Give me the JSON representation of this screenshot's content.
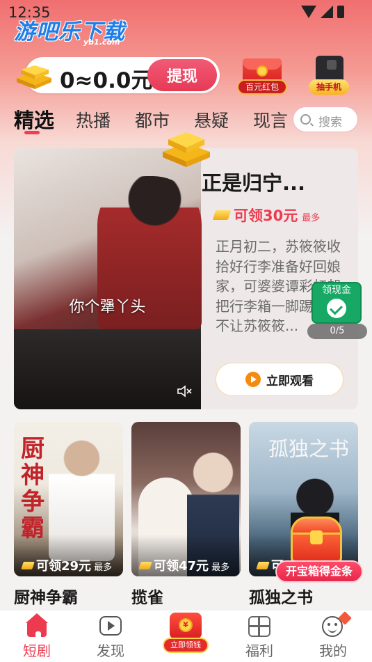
{
  "status_bar": {
    "time": "12:35"
  },
  "logo": {
    "name": "游吧乐下载",
    "domain": "yb1.com"
  },
  "coins": {
    "balance": "0≈0.0元",
    "withdraw_label": "提现"
  },
  "promos": {
    "red_packet_label": "百元红包",
    "phone_label": "抽手机"
  },
  "tabs": [
    {
      "label": "精选",
      "active": true
    },
    {
      "label": "热播"
    },
    {
      "label": "都市"
    },
    {
      "label": "悬疑"
    },
    {
      "label": "现言"
    }
  ],
  "search": {
    "placeholder": "搜索"
  },
  "featured": {
    "title": "正是归宁...",
    "reward": "可领30元",
    "reward_more": "最多",
    "description": "正月初二，苏筱筱收拾好行李准备好回娘家，可婆婆谭彩虹却把行李箱一脚踢翻，不让苏筱筱...",
    "subtitle": "你个犟丫头",
    "watch_label": "立即观看"
  },
  "cash_widget": {
    "title": "领现金",
    "progress": "0/5"
  },
  "dramas": [
    {
      "title": "厨神争霸",
      "cover_text": "厨神争霸",
      "reward": "可领29元",
      "reward_more": "最多"
    },
    {
      "title": "揽雀",
      "reward": "可领47元",
      "reward_more": "最多"
    },
    {
      "title": "孤独之书",
      "cover_text": "孤独之书",
      "reward": "可",
      "reward_more": ""
    }
  ],
  "treasure_chest": {
    "label": "开宝箱得金条"
  },
  "bottom_nav": {
    "items": [
      {
        "label": "短剧",
        "icon": "home-icon",
        "active": true
      },
      {
        "label": "发现",
        "icon": "video-icon"
      },
      {
        "label": "立即领钱",
        "icon": "red-envelope-icon"
      },
      {
        "label": "福利",
        "icon": "gift-icon"
      },
      {
        "label": "我的",
        "icon": "profile-icon"
      }
    ]
  },
  "colors": {
    "accent": "#ee3a4f",
    "gold": "#f1a915",
    "cash_green": "#16a864"
  }
}
